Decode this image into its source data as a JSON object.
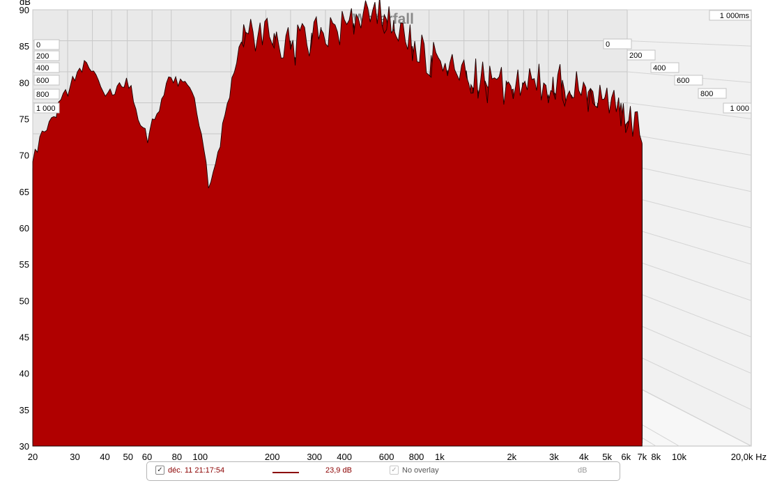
{
  "chart_data": {
    "type": "area",
    "title": "Waterfall",
    "y_unit": "dB",
    "x_unit": "Hz",
    "ylim": [
      30,
      90
    ],
    "y_ticks": [
      "90",
      "85",
      "80",
      "75",
      "70",
      "65",
      "60",
      "55",
      "50",
      "45",
      "40",
      "35",
      "30"
    ],
    "x_scale": "log",
    "xlim": [
      20,
      20000
    ],
    "x_ticks": [
      {
        "label": "20",
        "value": 20
      },
      {
        "label": "30",
        "value": 30
      },
      {
        "label": "40",
        "value": 40
      },
      {
        "label": "50",
        "value": 50
      },
      {
        "label": "60",
        "value": 60
      },
      {
        "label": "80",
        "value": 80
      },
      {
        "label": "100",
        "value": 100
      },
      {
        "label": "200",
        "value": 200
      },
      {
        "label": "300",
        "value": 300
      },
      {
        "label": "400",
        "value": 400
      },
      {
        "label": "600",
        "value": 600
      },
      {
        "label": "800",
        "value": 800
      },
      {
        "label": "1k",
        "value": 1000
      },
      {
        "label": "2k",
        "value": 2000
      },
      {
        "label": "3k",
        "value": 3000
      },
      {
        "label": "4k",
        "value": 4000
      },
      {
        "label": "5k",
        "value": 5000
      },
      {
        "label": "6k",
        "value": 6000
      },
      {
        "label": "7k",
        "value": 7000
      },
      {
        "label": "8k",
        "value": 8000
      },
      {
        "label": "10k",
        "value": 10000
      },
      {
        "label": "20,0k Hz",
        "value": 20000
      }
    ],
    "time_unit_label": "1 000ms",
    "time_ticks_left": [
      "0",
      "200",
      "400",
      "600",
      "800",
      "1 000"
    ],
    "time_ticks_right": [
      "0",
      "200",
      "400",
      "600",
      "800",
      "1 000"
    ],
    "slices_ms": [
      0,
      50,
      100,
      150,
      200,
      250,
      300,
      350,
      400,
      450,
      500,
      550,
      600,
      650,
      700,
      750,
      800,
      850,
      900,
      950,
      1000
    ],
    "grid": true,
    "series_color": "#b00000",
    "frequency_range_hz": [
      20,
      7000
    ],
    "front_slice_db": [
      {
        "hz": 20,
        "db": 70
      },
      {
        "hz": 33,
        "db": 83
      },
      {
        "hz": 40,
        "db": 78
      },
      {
        "hz": 50,
        "db": 80
      },
      {
        "hz": 60,
        "db": 72
      },
      {
        "hz": 75,
        "db": 81
      },
      {
        "hz": 95,
        "db": 78
      },
      {
        "hz": 110,
        "db": 65
      },
      {
        "hz": 150,
        "db": 87
      },
      {
        "hz": 250,
        "db": 85
      },
      {
        "hz": 400,
        "db": 88
      },
      {
        "hz": 600,
        "db": 89
      },
      {
        "hz": 900,
        "db": 83
      },
      {
        "hz": 1500,
        "db": 80
      },
      {
        "hz": 2000,
        "db": 79
      },
      {
        "hz": 3000,
        "db": 80
      },
      {
        "hz": 4000,
        "db": 79
      },
      {
        "hz": 6000,
        "db": 76
      },
      {
        "hz": 7000,
        "db": 74
      }
    ],
    "floor_db": 39
  },
  "legend": {
    "measurement_checked": "✓",
    "measurement_label": "déc. 11 21:17:54",
    "measurement_value": "23,9 dB",
    "overlay_checked": "✓",
    "overlay_label": "No overlay",
    "overlay_value": "dB"
  }
}
